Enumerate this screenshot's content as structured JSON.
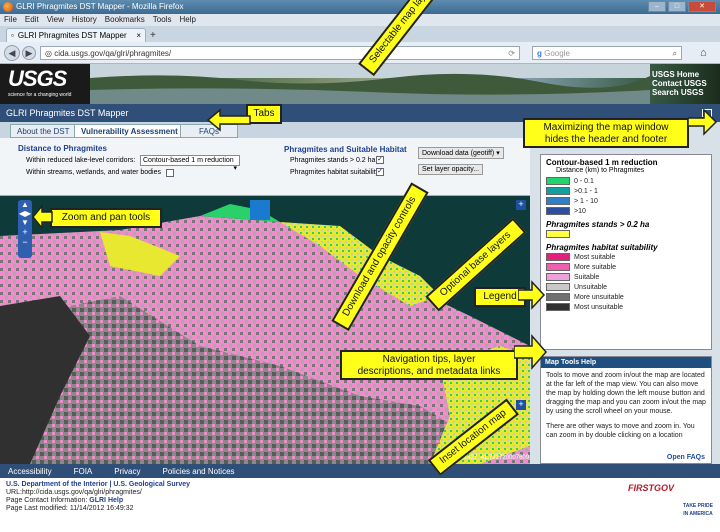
{
  "browser": {
    "title": "GLRI Phragmites DST Mapper - Mozilla Firefox",
    "menu": [
      "File",
      "Edit",
      "View",
      "History",
      "Bookmarks",
      "Tools",
      "Help"
    ],
    "tab_title": "GLRI Phragmites DST Mapper",
    "url": "cida.usgs.gov/qa/glri/phragmites/",
    "search_placeholder": "Google"
  },
  "header": {
    "logo": "USGS",
    "tagline": "science for a changing world",
    "links": [
      "USGS Home",
      "Contact USGS",
      "Search USGS"
    ]
  },
  "app": {
    "title": "GLRI Phragmites DST Mapper",
    "tabs": [
      "About the DST",
      "Vulnerability Assessment Map",
      "FAQs"
    ]
  },
  "controls": {
    "distance_heading": "Distance to Phragmites",
    "row1": "Within reduced lake-level corridors:",
    "select_value": "Contour-based 1 m reduction",
    "row2": "Within streams, wetlands, and water bodies",
    "habitat_heading": "Phragmites and Suitable Habitat",
    "stands": "Phragmites stands > 0.2 ha",
    "suitability": "Phragmites habitat suitability",
    "download": "Download data (geotiff)",
    "opacity": "Set layer opacity..."
  },
  "legend": {
    "title": "Contour-based 1 m reduction",
    "subtitle": "Distance (km) to Phragmites",
    "distance": [
      {
        "label": "0 - 0.1",
        "color": "#1fd46a"
      },
      {
        "label": ">0.1 - 1",
        "color": "#0fa0a0"
      },
      {
        "label": "> 1 - 10",
        "color": "#3080c8"
      },
      {
        "label": ">10",
        "color": "#2a4fa0"
      }
    ],
    "stands_title": "Phragmites stands > 0.2 ha",
    "stands_color": "#ffff44",
    "habitat_title": "Phragmites habitat suitability",
    "habitat": [
      {
        "label": "Most suitable",
        "color": "#e0207a"
      },
      {
        "label": "More suitable",
        "color": "#f060b0"
      },
      {
        "label": "Suitable",
        "color": "#f0a0d8"
      },
      {
        "label": "Unsuitable",
        "color": "#c8c8c8"
      },
      {
        "label": "More unsuitable",
        "color": "#707070"
      },
      {
        "label": "Most unsuitable",
        "color": "#303030"
      }
    ]
  },
  "tools": {
    "heading": "Map Tools Help",
    "body1": "Tools to move and zoom in/out the map are located at the far left of the map view. You can also move the map by holding down the left mouse button and dragging the map and you can zoom in/out the map by using the scroll wheel on your mouse.",
    "body2": "There are other ways to move and zoom in. You can zoom in by double clicking on a location",
    "faq": "Open FAQs"
  },
  "map": {
    "coords": "-9571427, 41.722720007609"
  },
  "footer": {
    "links": [
      "Accessibility",
      "FOIA",
      "Privacy",
      "Policies and Notices"
    ],
    "dept": "U.S. Department of the Interior | U.S. Geological Survey",
    "url": "URL:http://cida.usgs.gov/qa/glri/phragmites/",
    "contact_prefix": "Page Contact Information:",
    "contact": "GLRI Help",
    "modified": "Page Last modified: 11/14/2012 16:49:32",
    "firstgov": "FIRSTGOV",
    "pride": "TAKE PRIDE IN AMERICA"
  },
  "annotations": {
    "tabs": "Tabs",
    "layers": "Selectable map layers",
    "maximize1": "Maximizing the map window",
    "maximize2": "hides the header and footer",
    "zoom": "Zoom and pan tools",
    "download": "Download and opacity controls",
    "base": "Optional base layers",
    "legend": "Legend",
    "nav1": "Navigation tips, layer",
    "nav2": "descriptions, and metadata links",
    "inset": "Inset location map"
  }
}
